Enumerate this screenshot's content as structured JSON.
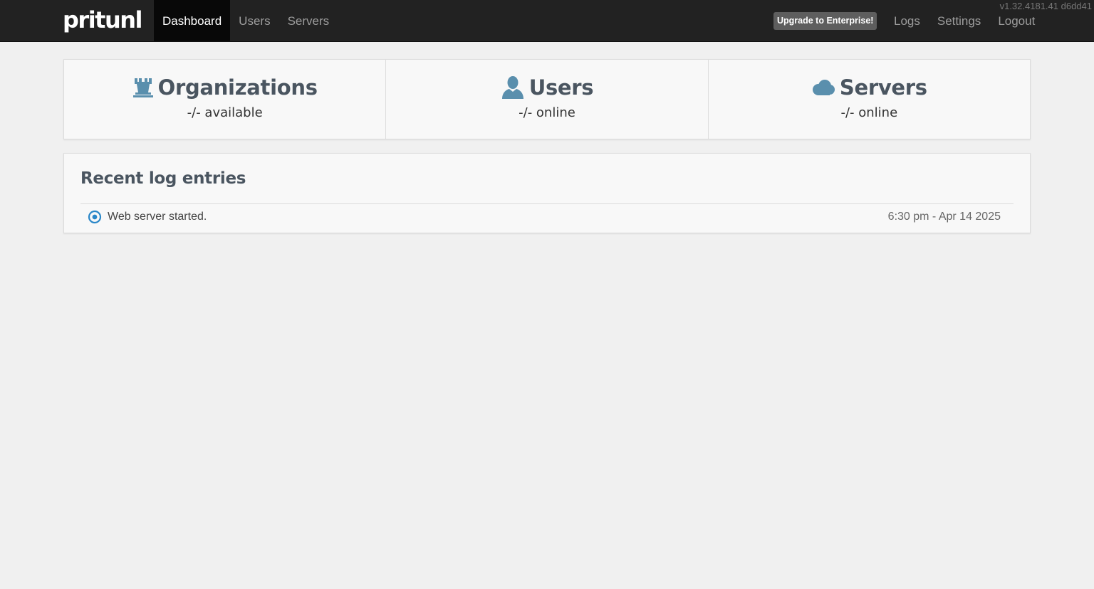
{
  "navbar": {
    "brand": "pritunl",
    "left_items": [
      {
        "label": "Dashboard",
        "active": true
      },
      {
        "label": "Users",
        "active": false
      },
      {
        "label": "Servers",
        "active": false
      }
    ],
    "upgrade_label": "Upgrade to Enterprise!",
    "right_items": [
      {
        "label": "Logs"
      },
      {
        "label": "Settings"
      },
      {
        "label": "Logout"
      }
    ],
    "version": "v1.32.4181.41 d6dd41"
  },
  "stats": [
    {
      "icon": "tower-icon",
      "title": "Organizations",
      "subtitle": "-/- available"
    },
    {
      "icon": "user-icon",
      "title": "Users",
      "subtitle": "-/- online"
    },
    {
      "icon": "cloud-icon",
      "title": "Servers",
      "subtitle": "-/- online"
    }
  ],
  "logs": {
    "title": "Recent log entries",
    "entries": [
      {
        "icon": "record-icon",
        "message": "Web server started.",
        "time": "6:30 pm - Apr 14 2025"
      }
    ]
  },
  "colors": {
    "navbar_bg": "#222222",
    "nav_active_bg": "#080808",
    "page_bg": "#f0f0f0",
    "panel_bg": "#f8f8f8",
    "icon_blue": "#5a8fad",
    "heading": "#4a5560",
    "log_icon": "#2a87c8"
  }
}
